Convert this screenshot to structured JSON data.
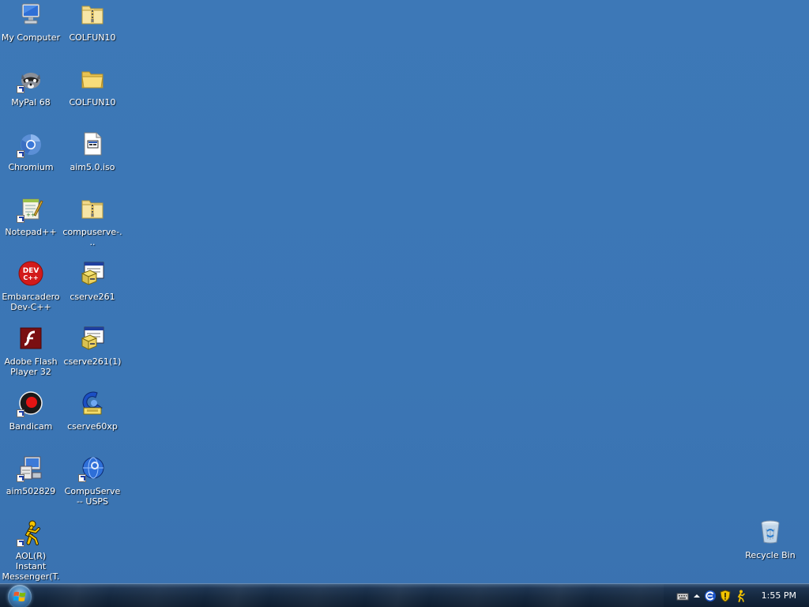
{
  "desktop": {
    "icons": [
      {
        "label": "My Computer",
        "icon": "my-computer-icon"
      },
      {
        "label": "COLFUN10",
        "icon": "zip-folder-icon"
      },
      {
        "label": "MyPal 68",
        "icon": "mypal-raccoon-icon",
        "shortcut": true
      },
      {
        "label": "COLFUN10",
        "icon": "folder-icon"
      },
      {
        "label": "Chromium",
        "icon": "chromium-icon",
        "shortcut": true
      },
      {
        "label": "aim5.0.iso",
        "icon": "iso-file-icon"
      },
      {
        "label": "Notepad++",
        "icon": "notepad-plus-plus-icon",
        "shortcut": true
      },
      {
        "label": "compuserve-...",
        "icon": "zip-folder-icon"
      },
      {
        "label": "Embarcadero Dev-C++",
        "icon": "dev-cpp-icon"
      },
      {
        "label": "cserve261",
        "icon": "installer-icon"
      },
      {
        "label": "Adobe Flash Player 32",
        "icon": "flash-player-icon"
      },
      {
        "label": "cserve261(1)",
        "icon": "installer-icon"
      },
      {
        "label": "Bandicam",
        "icon": "bandicam-icon",
        "shortcut": true
      },
      {
        "label": "cserve60xp",
        "icon": "compuserve-icon"
      },
      {
        "label": "aim502829",
        "icon": "setup-computer-icon"
      },
      {
        "label": "CompuServe -- USPS",
        "icon": "compuserve-globe-icon",
        "shortcut": true
      },
      {
        "label": "AOL(R) Instant Messenger(T...",
        "icon": "aim-running-man-icon",
        "shortcut": true
      }
    ],
    "recycle_bin": {
      "label": "Recycle Bin",
      "icon": "recycle-bin-icon"
    }
  },
  "taskbar": {
    "start_icon": "windows-start-orb-icon",
    "tray_icons": [
      "keyboard-icon",
      "show-hidden-icons-chevron-icon",
      "compuserve-e-icon",
      "security-shield-icon",
      "aim-tray-icon"
    ],
    "clock": "1:55 PM"
  },
  "colors": {
    "desktop_background": "#3b76b5",
    "taskbar": "#15283f",
    "label_text": "#ffffff"
  }
}
